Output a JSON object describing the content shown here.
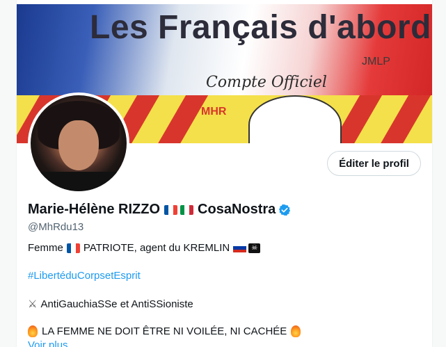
{
  "banner": {
    "title": "Les Français d'abord",
    "subtitle": "JMLP",
    "official": "Compte Officiel",
    "lower_label": "MHR"
  },
  "profile": {
    "edit_button": "Éditer le profil",
    "display_name_part1": "Marie-Hélène RIZZO",
    "display_name_part2": "CosaNostra",
    "handle": "@MhRdu13",
    "verified": true
  },
  "bio": {
    "line1_a": "Femme",
    "line1_b": "PATRIOTE, agent du KREMLIN",
    "hashtag": "#LibertéduCorpsetEsprit",
    "line3": "AntiGauchiaSSe et AntiSSioniste",
    "line4": "LA FEMME  NE DOIT  ÊTRE NI VOILÉE, NI CACHÉE",
    "more_link": "Voir plus"
  },
  "colors": {
    "accent": "#1d9bf0",
    "text": "#0f1419",
    "muted": "#536471"
  }
}
